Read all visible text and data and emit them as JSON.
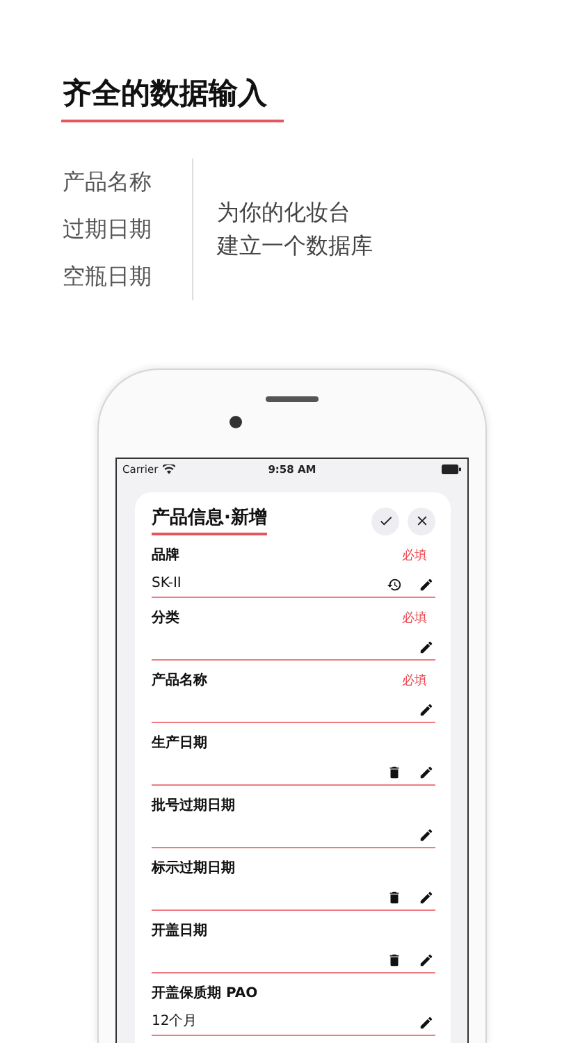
{
  "headline": "齐全的数据输入",
  "features": [
    "产品名称",
    "过期日期",
    "空瓶日期"
  ],
  "tagline": [
    "为你的化妆台",
    "建立一个数据库"
  ],
  "status_bar": {
    "carrier": "Carrier",
    "time": "9:58 AM"
  },
  "form": {
    "title": "产品信息·新增",
    "buttons": [
      {
        "kind": "confirm"
      },
      {
        "kind": "close"
      }
    ],
    "fields": [
      {
        "label": "品牌",
        "badge": "必填",
        "value": "SK-II",
        "buttons": [
          {
            "kind": "history"
          },
          {
            "kind": "edit"
          }
        ]
      },
      {
        "label": "分类",
        "badge": "必填",
        "buttons": [
          {
            "kind": "edit"
          }
        ]
      },
      {
        "label": "产品名称",
        "badge": "必填",
        "buttons": [
          {
            "kind": "edit"
          }
        ]
      },
      {
        "label": "生产日期",
        "buttons": [
          {
            "kind": "delete"
          },
          {
            "kind": "edit"
          }
        ]
      },
      {
        "label": "批号过期日期",
        "buttons": [
          {
            "kind": "edit"
          }
        ]
      },
      {
        "label": "标示过期日期",
        "buttons": [
          {
            "kind": "delete"
          },
          {
            "kind": "edit"
          }
        ]
      },
      {
        "label": "开盖日期",
        "buttons": [
          {
            "kind": "delete"
          },
          {
            "kind": "edit"
          }
        ]
      },
      {
        "label": "开盖保质期 PAO",
        "value": "12个月",
        "buttons": [
          {
            "kind": "edit"
          }
        ]
      }
    ]
  }
}
